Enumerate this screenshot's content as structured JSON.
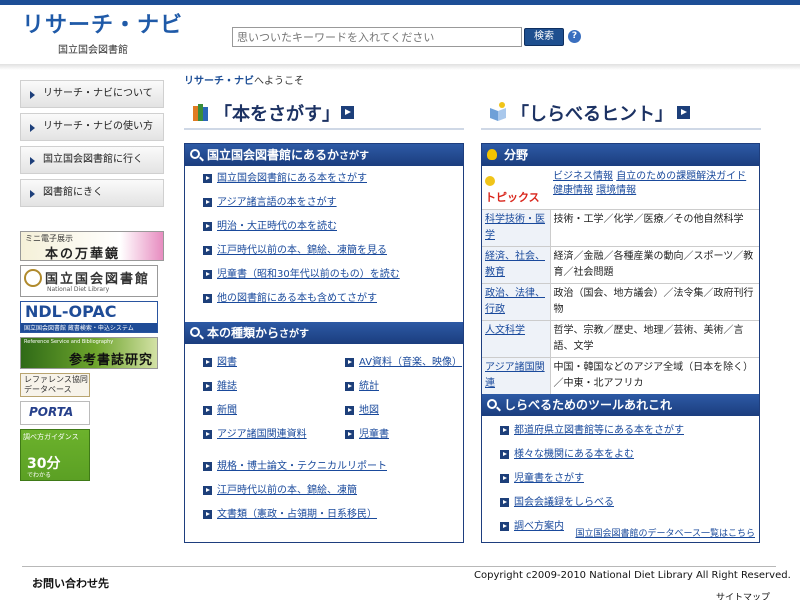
{
  "header": {
    "logo_main": "リサーチ・ナビ",
    "logo_sub": "国立国会図書館",
    "search_placeholder": "思いついたキーワードを入れてください",
    "search_button": "検索"
  },
  "sidebar": {
    "items": [
      {
        "label": "リサーチ・ナビについて"
      },
      {
        "label": "リサーチ・ナビの使い方"
      },
      {
        "label": "国立国会図書館に行く"
      },
      {
        "label": "図書館にきく"
      }
    ]
  },
  "banners": {
    "b1": {
      "top": "ミニ電子展示",
      "main": "本の万華鏡"
    },
    "b2": {
      "main": "国立国会図書館",
      "sub": "National Diet Library"
    },
    "b3": {
      "main": "NDL-OPAC",
      "sub": "国立国会図書館 蔵書検索・申込システム"
    },
    "b4": {
      "top": "Reference Service and Bibliography",
      "main": "参考書誌研究"
    },
    "b5": {
      "main": "レファレンス協同データベース"
    },
    "b6": {
      "main": "PORTA"
    },
    "b7": {
      "top": "調べ方ガイダンス",
      "main": "30分",
      "sub": "でわかる"
    }
  },
  "welcome": {
    "brand": "リサーチ・ナビ",
    "text": "へようこそ"
  },
  "left_section": {
    "title": "「本をさがす」",
    "panel1": {
      "title": "国立国会図書館にあるか",
      "title_small": "さがす",
      "links": [
        "国立国会図書館にある本をさがす",
        "アジア諸言語の本をさがす",
        "明治・大正時代の本を読む",
        "江戸時代以前の本、錦絵、凍簡を見る",
        "児童書（昭和30年代以前のもの）を読む",
        "他の図書館にある本も含めてさがす"
      ]
    },
    "panel2": {
      "title": "本の種類から",
      "title_small": "さがす",
      "grid": [
        [
          "図書",
          "AV資料（音楽、映像）"
        ],
        [
          "雑誌",
          "統計"
        ],
        [
          "新聞",
          "地図"
        ],
        [
          "アジア諸国関連資料",
          "児童書"
        ]
      ],
      "links": [
        "規格・博士論文・テクニカルリポート",
        "江戸時代以前の本、錦絵、凍簡",
        "文書類（憲政・占領期・日系移民）"
      ]
    }
  },
  "right_section": {
    "title": "「しらべるヒント」",
    "panel1": {
      "title": "分野",
      "topics_label": "トピックス",
      "topics_links": [
        "ビジネス情報",
        "自立のための課題解決ガイド",
        "健康情報",
        "環境情報"
      ],
      "rows": [
        {
          "key": "科学技術・医学",
          "value": "技術・工学／化学／医療／その他自然科学"
        },
        {
          "key": "経済、社会、教育",
          "value": "経済／金融／各種産業の動向／スポーツ／教育／社会問題"
        },
        {
          "key": "政治、法律、行政",
          "value": "政治（国会、地方議会）／法令集／政府刊行物"
        },
        {
          "key": "人文科学",
          "value": "哲学、宗教／歴史、地理／芸術、美術／言語、文学"
        },
        {
          "key": "アジア諸国関連",
          "value": "中国・韓国などのアジア全域（日本を除く）／中東・北アフリカ"
        }
      ]
    },
    "panel2": {
      "title": "しらべるためのツールあれこれ",
      "links": [
        "都道府県立図書館等にある本をさがす",
        "様々な機関にある本をよむ",
        "児童書をさがす",
        "国会会議録をしらべる",
        "調べ方案内"
      ],
      "db_link": "国立国会図書館のデータベース一覧はこちら"
    }
  },
  "footer": {
    "contact": "お問い合わせ先",
    "copyright": "Copyright c2009-2010 National Diet Library All Right Reserved.",
    "sitemap": "サイトマップ"
  },
  "colors": {
    "brand_blue": "#1d4e96",
    "panel_bar": "#1b3d7e",
    "link": "#1a4a9c",
    "topics_red": "#d9261c"
  }
}
